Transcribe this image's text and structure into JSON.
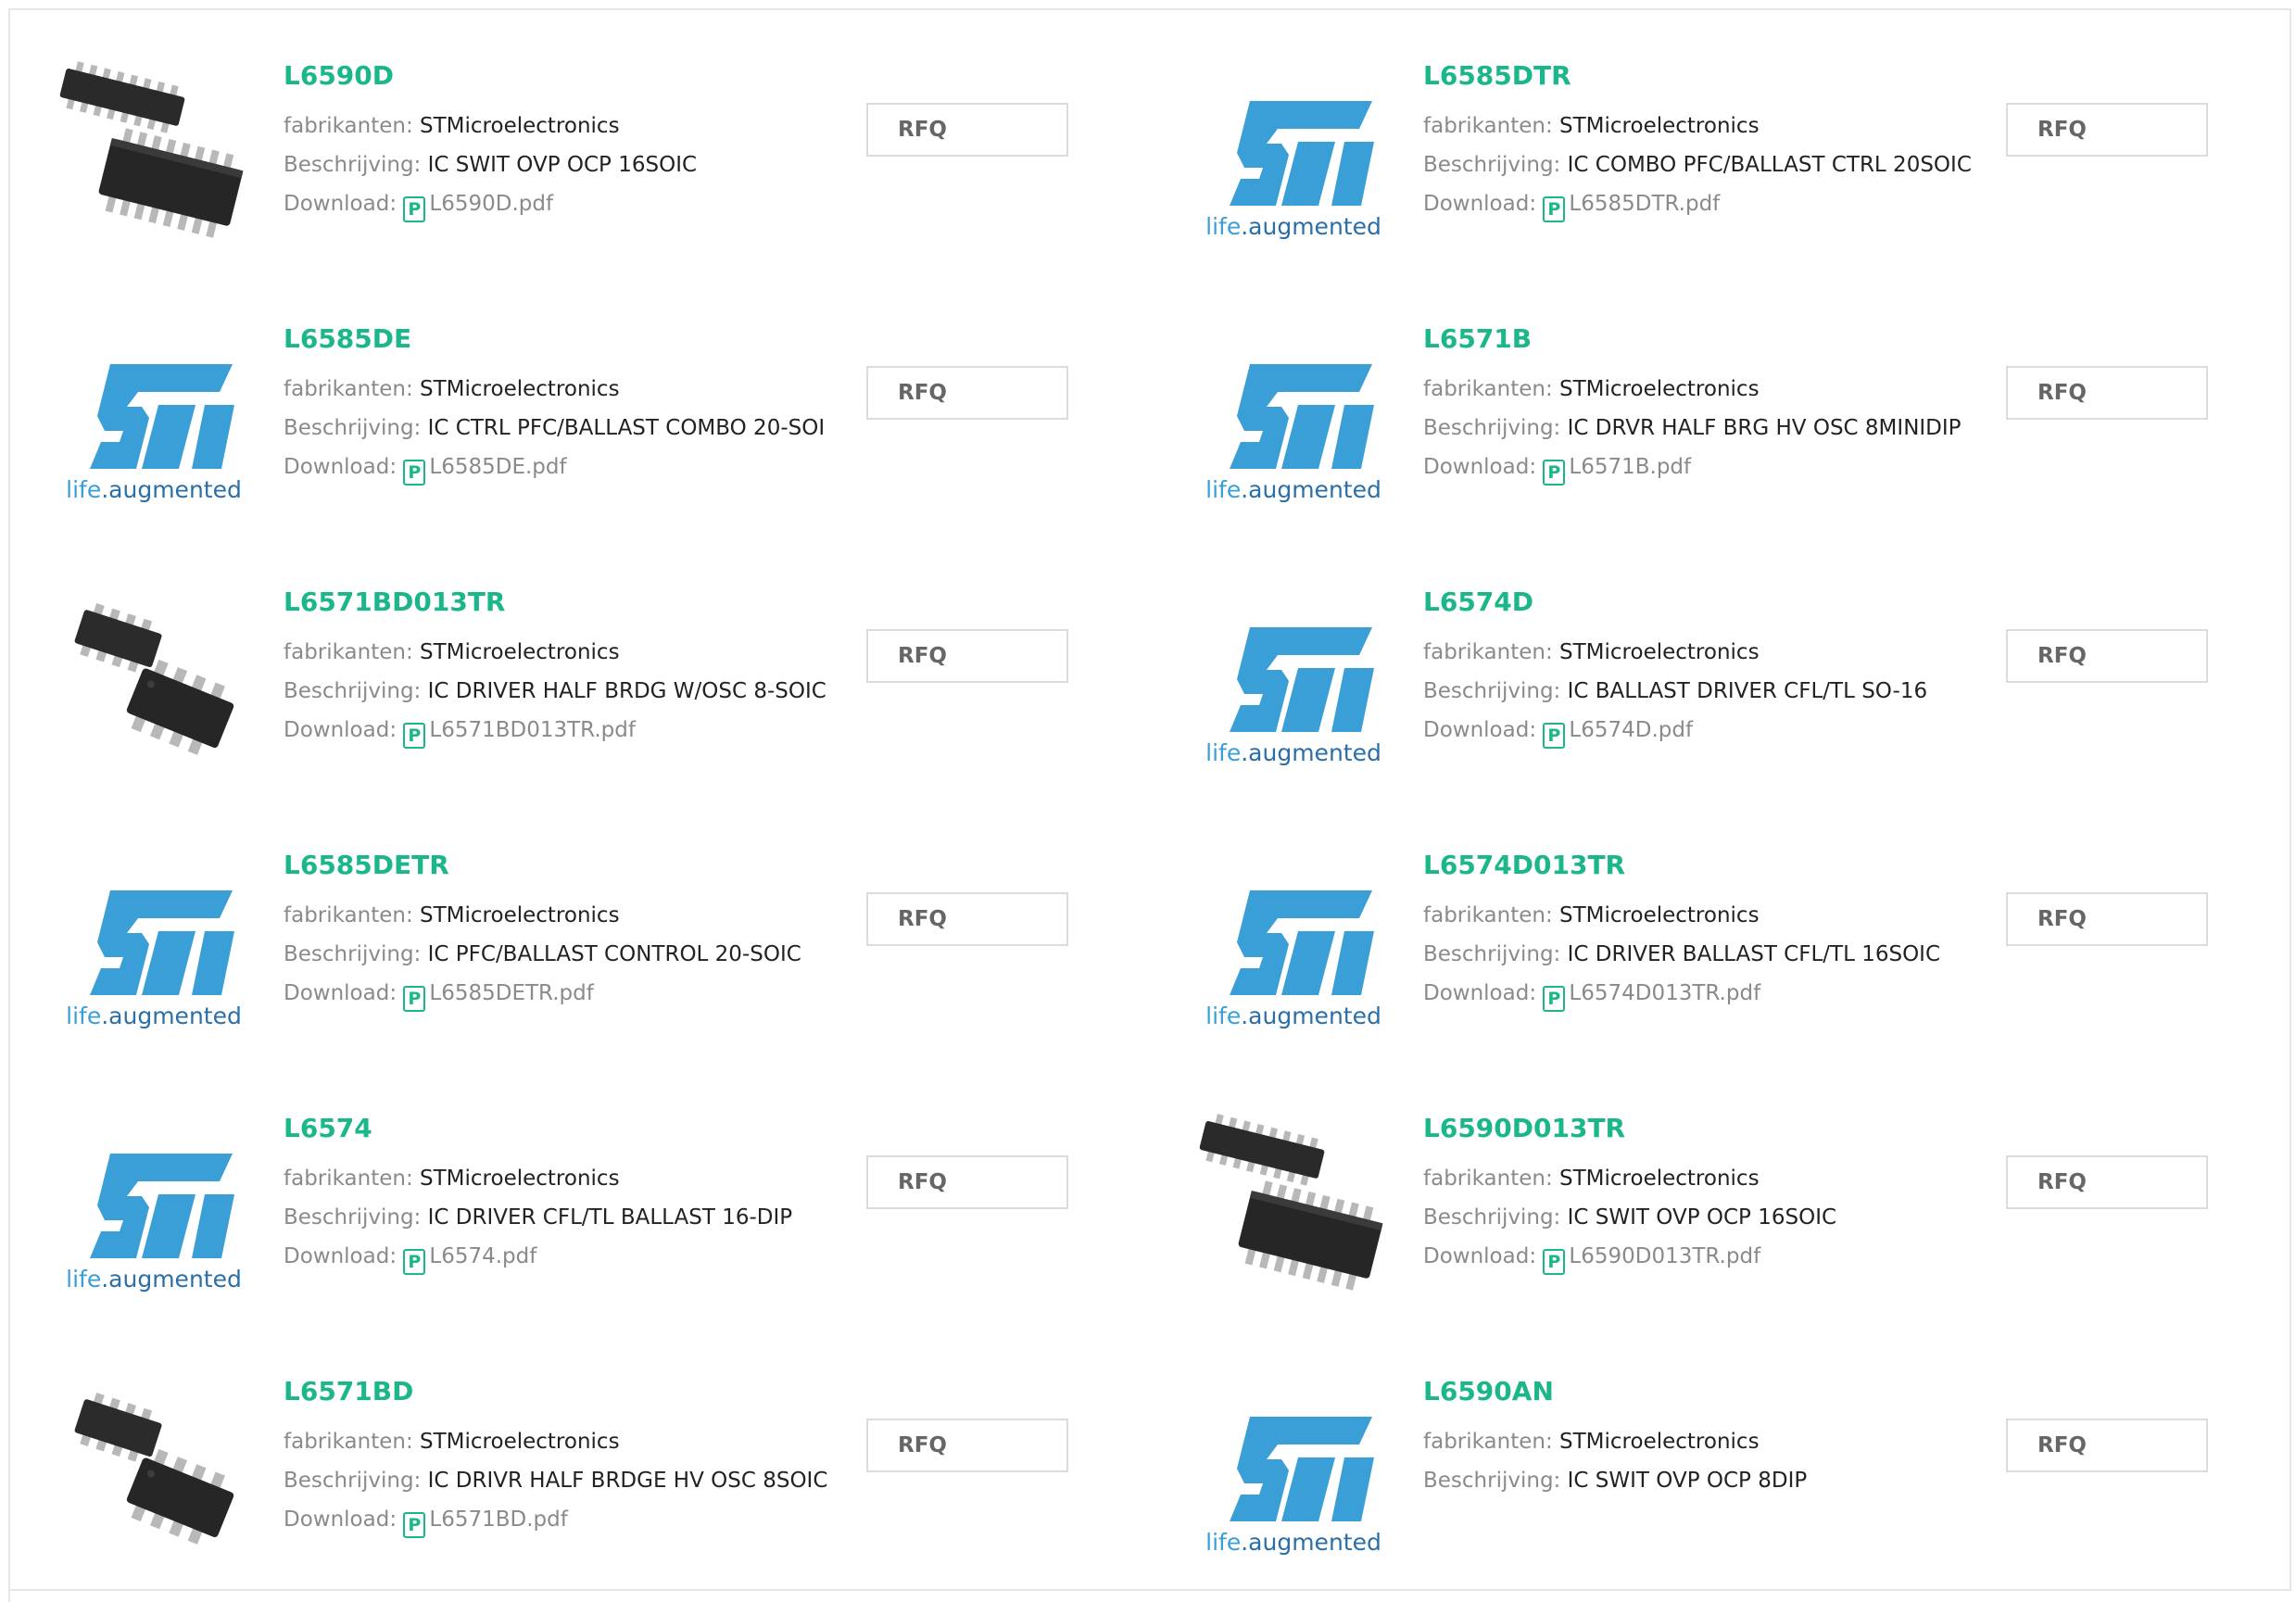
{
  "labels": {
    "manufacturer": "fabrikanten:",
    "description": "Beschrijving:",
    "download": "Download:",
    "rfq": "RFQ",
    "pdf_glyph": "P"
  },
  "logo": {
    "text_life": "life",
    "text_dot": ".",
    "text_augmented": "augmented",
    "brand_color": "#3a9fd6"
  },
  "colors": {
    "part_number": "#1bb68a",
    "label_gray": "#8a8a8a",
    "border": "#e6e6e6"
  },
  "products": [
    {
      "part": "L6590D",
      "manufacturer": "STMicroelectronics",
      "description": "IC SWIT OVP OCP 16SOIC",
      "pdf": "L6590D.pdf",
      "image": "soic16-chip-image"
    },
    {
      "part": "L6585DTR",
      "manufacturer": "STMicroelectronics",
      "description": "IC COMBO PFC/BALLAST CTRL 20SOIC",
      "pdf": "L6585DTR.pdf",
      "image": "st-logo"
    },
    {
      "part": "L6585DE",
      "manufacturer": "STMicroelectronics",
      "description": "IC CTRL PFC/BALLAST COMBO 20-SOI",
      "pdf": "L6585DE.pdf",
      "image": "st-logo"
    },
    {
      "part": "L6571B",
      "manufacturer": "STMicroelectronics",
      "description": "IC DRVR HALF BRG HV OSC 8MINIDIP",
      "pdf": "L6571B.pdf",
      "image": "st-logo"
    },
    {
      "part": "L6571BD013TR",
      "manufacturer": "STMicroelectronics",
      "description": "IC DRIVER HALF BRDG W/OSC 8-SOIC",
      "pdf": "L6571BD013TR.pdf",
      "image": "soic8-chip-image"
    },
    {
      "part": "L6574D",
      "manufacturer": "STMicroelectronics",
      "description": "IC BALLAST DRIVER CFL/TL SO-16",
      "pdf": "L6574D.pdf",
      "image": "st-logo"
    },
    {
      "part": "L6585DETR",
      "manufacturer": "STMicroelectronics",
      "description": "IC PFC/BALLAST CONTROL 20-SOIC",
      "pdf": "L6585DETR.pdf",
      "image": "st-logo"
    },
    {
      "part": "L6574D013TR",
      "manufacturer": "STMicroelectronics",
      "description": "IC DRIVER BALLAST CFL/TL 16SOIC",
      "pdf": "L6574D013TR.pdf",
      "image": "st-logo"
    },
    {
      "part": "L6574",
      "manufacturer": "STMicroelectronics",
      "description": "IC DRIVER CFL/TL BALLAST 16-DIP",
      "pdf": "L6574.pdf",
      "image": "st-logo"
    },
    {
      "part": "L6590D013TR",
      "manufacturer": "STMicroelectronics",
      "description": "IC SWIT OVP OCP 16SOIC",
      "pdf": "L6590D013TR.pdf",
      "image": "soic16-chip-image"
    },
    {
      "part": "L6571BD",
      "manufacturer": "STMicroelectronics",
      "description": "IC DRIVR HALF BRDGE HV OSC 8SOIC",
      "pdf": "L6571BD.pdf",
      "image": "soic8-chip-image"
    },
    {
      "part": "L6590AN",
      "manufacturer": "STMicroelectronics",
      "description": "IC SWIT OVP OCP 8DIP",
      "pdf": "",
      "image": "st-logo"
    }
  ]
}
